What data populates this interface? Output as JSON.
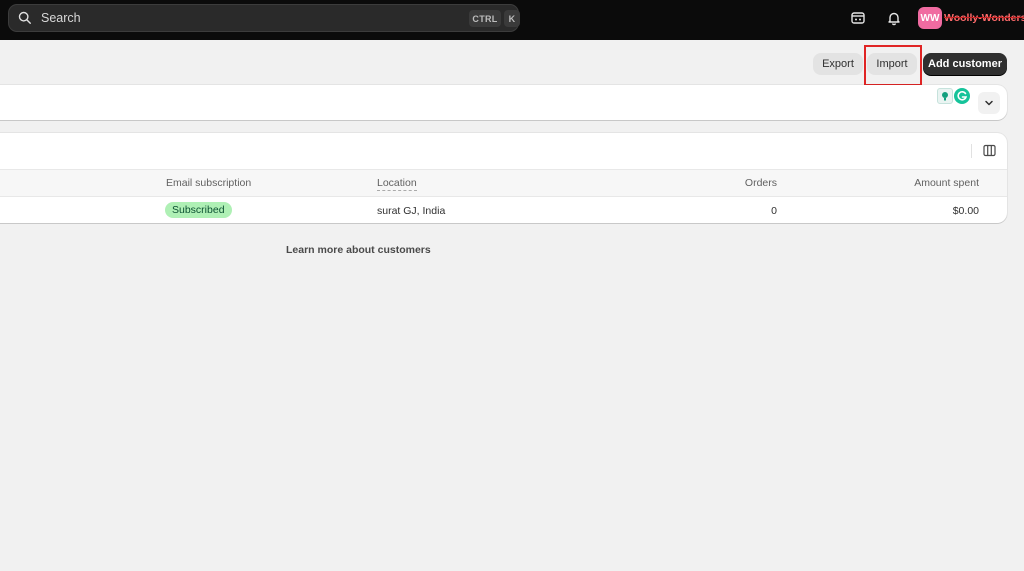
{
  "topbar": {
    "search_placeholder": "Search",
    "shortcut_ctrl": "CTRL",
    "shortcut_k": "K",
    "avatar_initials": "WW",
    "store_name": "Woolly-Wonders"
  },
  "actions": {
    "export_label": "Export",
    "import_label": "Import",
    "add_customer_label": "Add customer"
  },
  "table": {
    "columns": {
      "email_subscription": "Email subscription",
      "location": "Location",
      "orders": "Orders",
      "amount_spent": "Amount spent"
    },
    "rows": [
      {
        "email_subscription": "Subscribed",
        "location": "surat GJ, India",
        "orders": "0",
        "amount_spent": "$0.00"
      }
    ]
  },
  "footer": {
    "learn_more": "Learn more about customers"
  },
  "colors": {
    "topbar_bg": "#0b0b0b",
    "primary_button": "#303030",
    "subscribed_badge": "#aff0b5",
    "avatar": "#f06ba1",
    "highlight": "#e02424"
  },
  "icons": [
    "search-icon",
    "store-icon",
    "bell-icon",
    "bulb-icon",
    "grammarly-icon",
    "chevron-down-icon",
    "columns-icon"
  ]
}
